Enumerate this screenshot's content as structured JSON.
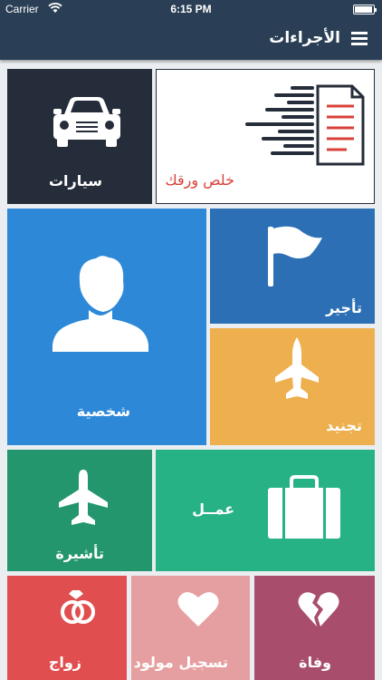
{
  "status": {
    "carrier": "Carrier",
    "time": "6:15 PM"
  },
  "nav": {
    "title": "الأجراءات"
  },
  "tiles": {
    "cars": "سيارات",
    "paper": "خلص ورقك",
    "person": "شخصية",
    "rent": "تأجير",
    "army": "تجنيد",
    "visa": "تأشيرة",
    "work": "عمــل",
    "marry": "زواج",
    "birth": "تسجيل مولود",
    "death": "وفاة"
  },
  "colors": {
    "navbar": "#2a3f55",
    "cars": "#252d3a",
    "person": "#2d89d8",
    "rent": "#2c6fb5",
    "army": "#eeaf4e",
    "visa": "#24966d",
    "work": "#27b286",
    "marry": "#e14e4f",
    "birth": "#e69fa0",
    "death": "#a84e6c",
    "paper_accent": "#d8413a"
  },
  "icons": [
    "wifi-icon",
    "battery-icon",
    "menu-icon",
    "car-icon",
    "paper-icon",
    "person-icon",
    "flag-icon",
    "jet-icon",
    "plane-icon",
    "briefcase-icon",
    "rings-icon",
    "heart-icon",
    "broken-heart-icon"
  ]
}
